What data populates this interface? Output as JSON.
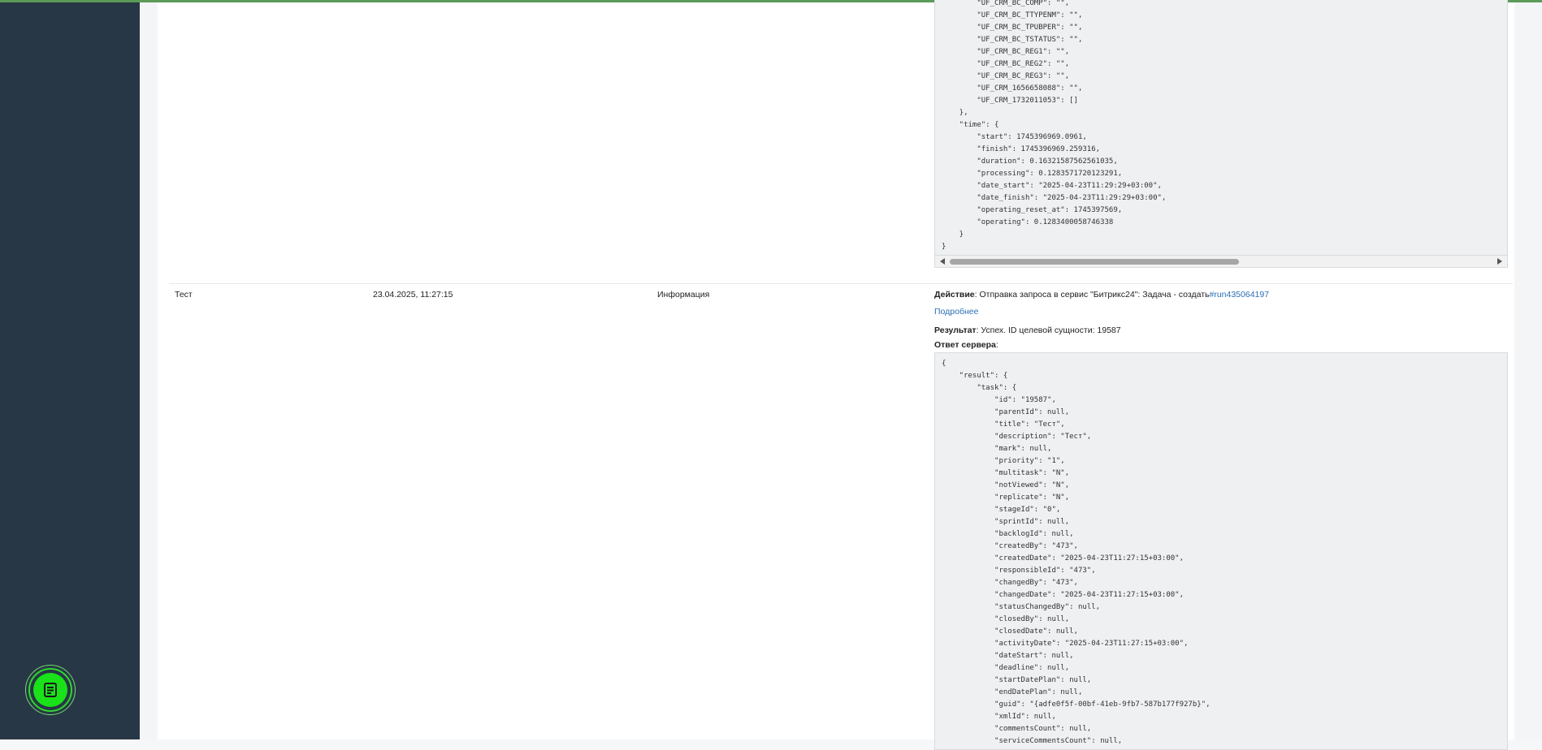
{
  "code_block_1_lines": [
    "        \"UF_CRM_BC_COMP\": \"\",",
    "        \"UF_CRM_BC_TTYPENM\": \"\",",
    "        \"UF_CRM_BC_TPUBPER\": \"\",",
    "        \"UF_CRM_BC_TSTATUS\": \"\",",
    "        \"UF_CRM_BC_REG1\": \"\",",
    "        \"UF_CRM_BC_REG2\": \"\",",
    "        \"UF_CRM_BC_REG3\": \"\",",
    "        \"UF_CRM_1656658088\": \"\",",
    "        \"UF_CRM_1732011053\": []",
    "    },",
    "    \"time\": {",
    "        \"start\": 1745396969.0961,",
    "        \"finish\": 1745396969.259316,",
    "        \"duration\": 0.16321587562561035,",
    "        \"processing\": 0.1283571720123291,",
    "        \"date_start\": \"2025-04-23T11:29:29+03:00\",",
    "        \"date_finish\": \"2025-04-23T11:29:29+03:00\",",
    "        \"operating_reset_at\": 1745397569,",
    "        \"operating\": 0.1283400058746338",
    "    }",
    "}"
  ],
  "row": {
    "name": "Тест",
    "datetime": "23.04.2025, 11:27:15",
    "level": "Информация",
    "action_label": "Действие",
    "action_text": ": Отправка запроса в сервис \"Битрикс24\": Задача - создать",
    "action_link": "#run435064197",
    "details_link": "Подробнее",
    "result_label": "Результат",
    "result_text": ": Успех. ID целевой сущности: 19587",
    "response_label": "Ответ сервера",
    "response_colon": ":"
  },
  "code_block_2_lines": [
    "{",
    "    \"result\": {",
    "        \"task\": {",
    "            \"id\": \"19587\",",
    "            \"parentId\": null,",
    "            \"title\": \"Тест\",",
    "            \"description\": \"Тест\",",
    "            \"mark\": null,",
    "            \"priority\": \"1\",",
    "            \"multitask\": \"N\",",
    "            \"notViewed\": \"N\",",
    "            \"replicate\": \"N\",",
    "            \"stageId\": \"0\",",
    "            \"sprintId\": null,",
    "            \"backlogId\": null,",
    "            \"createdBy\": \"473\",",
    "            \"createdDate\": \"2025-04-23T11:27:15+03:00\",",
    "            \"responsibleId\": \"473\",",
    "            \"changedBy\": \"473\",",
    "            \"changedDate\": \"2025-04-23T11:27:15+03:00\",",
    "            \"statusChangedBy\": null,",
    "            \"closedBy\": null,",
    "            \"closedDate\": null,",
    "            \"activityDate\": \"2025-04-23T11:27:15+03:00\",",
    "            \"dateStart\": null,",
    "            \"deadline\": null,",
    "            \"startDatePlan\": null,",
    "            \"endDatePlan\": null,",
    "            \"guid\": \"{adfe0f5f-00bf-41eb-9fb7-587b177f927b}\",",
    "            \"xmlId\": null,",
    "            \"commentsCount\": null,",
    "            \"serviceCommentsCount\": null,"
  ],
  "colors": {
    "sidebar": "#283746",
    "topbar": "#5b9a58",
    "link": "#2a6fb5",
    "fab": "#19e219",
    "code_bg": "#eef0f1"
  },
  "icons": {
    "fab": "document-lines-icon",
    "scroll_left": "arrow-left-icon",
    "scroll_right": "arrow-right-icon"
  }
}
